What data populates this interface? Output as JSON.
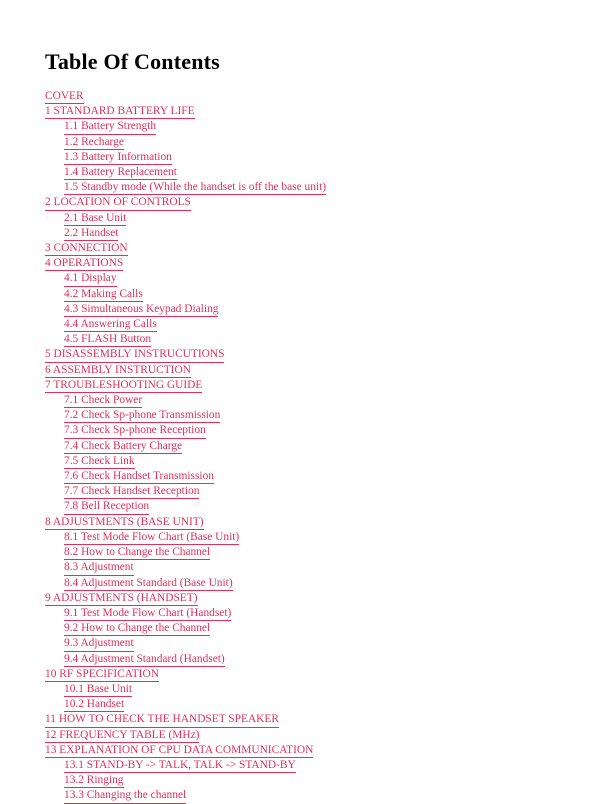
{
  "document": {
    "title": "Table Of Contents",
    "link_color": "#e0305a",
    "title_color": "#000000",
    "background_color": "#ffffff"
  },
  "toc": {
    "entries": [
      {
        "label": "COVER",
        "level": 1
      },
      {
        "label": "1 STANDARD BATTERY LIFE",
        "level": 1
      },
      {
        "label": "1.1 Battery Strength",
        "level": 2
      },
      {
        "label": "1.2 Recharge",
        "level": 2
      },
      {
        "label": "1.3 Battery Information",
        "level": 2
      },
      {
        "label": "1.4 Battery Replacement",
        "level": 2
      },
      {
        "label": "1.5 Standby mode (While the handset is off the base unit)",
        "level": 2
      },
      {
        "label": "2 LOCATION OF CONTROLS",
        "level": 1
      },
      {
        "label": "2.1 Base Unit",
        "level": 2
      },
      {
        "label": "2.2 Handset",
        "level": 2
      },
      {
        "label": "3 CONNECTION",
        "level": 1
      },
      {
        "label": "4 OPERATIONS",
        "level": 1
      },
      {
        "label": "4.1 Display",
        "level": 2
      },
      {
        "label": "4.2 Making Calls",
        "level": 2
      },
      {
        "label": "4.3 Simultaneous Keypad Dialing",
        "level": 2
      },
      {
        "label": "4.4 Answering Calls",
        "level": 2
      },
      {
        "label": "4.5 FLASH Button",
        "level": 2
      },
      {
        "label": "5 DISASSEMBLY INSTRUCUTIONS",
        "level": 1
      },
      {
        "label": "6 ASSEMBLY INSTRUCTION",
        "level": 1
      },
      {
        "label": "7 TROUBLESHOOTING GUIDE",
        "level": 1
      },
      {
        "label": "7.1 Check Power",
        "level": 2
      },
      {
        "label": "7.2 Check Sp-phone Transmission",
        "level": 2
      },
      {
        "label": "7.3 Check Sp-phone Reception",
        "level": 2
      },
      {
        "label": "7.4 Check Battery Charge",
        "level": 2
      },
      {
        "label": "7.5 Check Link",
        "level": 2
      },
      {
        "label": "7.6 Check Handset Transmission",
        "level": 2
      },
      {
        "label": "7.7 Check Handset Reception",
        "level": 2
      },
      {
        "label": "7.8 Bell Reception",
        "level": 2
      },
      {
        "label": "8 ADJUSTMENTS (BASE UNIT)",
        "level": 1
      },
      {
        "label": "8.1 Test Mode Flow Chart (Base Unit)",
        "level": 2
      },
      {
        "label": "8.2 How to Change the Channel",
        "level": 2
      },
      {
        "label": "8.3 Adjustment",
        "level": 2
      },
      {
        "label": "8.4 Adjustment Standard (Base Unit)",
        "level": 2
      },
      {
        "label": "9 ADJUSTMENTS (HANDSET)",
        "level": 1
      },
      {
        "label": "9.1 Test Mode Flow Chart (Handset)",
        "level": 2
      },
      {
        "label": "9.2 How to Change the Channel",
        "level": 2
      },
      {
        "label": "9.3 Adjustment",
        "level": 2
      },
      {
        "label": "9.4 Adjustment Standard (Handset)",
        "level": 2
      },
      {
        "label": "10 RF SPECIFICATION",
        "level": 1
      },
      {
        "label": "10.1 Base Unit",
        "level": 2
      },
      {
        "label": "10.2 Handset",
        "level": 2
      },
      {
        "label": "11 HOW TO CHECK THE HANDSET SPEAKER",
        "level": 1
      },
      {
        "label": "12 FREQUENCY TABLE (MHz)",
        "level": 1
      },
      {
        "label": "13 EXPLANATION OF CPU DATA COMMUNICATION",
        "level": 1
      },
      {
        "label": "13.1 STAND-BY -> TALK, TALK -> STAND-BY",
        "level": 2
      },
      {
        "label": "13.2 Ringing",
        "level": 2
      },
      {
        "label": "13.3 Changing the channel",
        "level": 2
      }
    ]
  }
}
